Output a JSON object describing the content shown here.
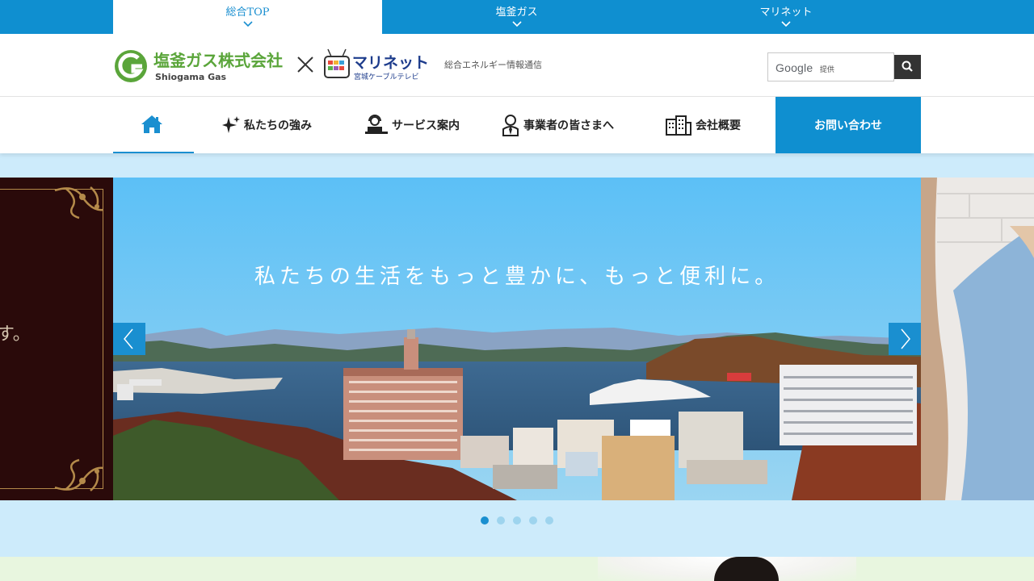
{
  "top_tabs": [
    {
      "label": "総合TOP",
      "active": true
    },
    {
      "label": "塩釜ガス",
      "active": false
    },
    {
      "label": "マリネット",
      "active": false
    }
  ],
  "header": {
    "logo_shiogama_jp": "塩釜ガス株式会社",
    "logo_shiogama_en": "Shiogama Gas",
    "logo_marinet": "マリネット",
    "logo_marinet_sub": "宮城ケーブルテレビ",
    "tagline": "総合エネルギー情報通信",
    "search_brand": "Google",
    "search_provided": "提供"
  },
  "nav": {
    "items": [
      {
        "label": "私たちの強み",
        "icon": "sparkle-icon"
      },
      {
        "label": "サービス案内",
        "icon": "operator-icon"
      },
      {
        "label": "事業者の皆さまへ",
        "icon": "businessperson-icon"
      },
      {
        "label": "会社概要",
        "icon": "building-icon"
      }
    ],
    "contact": "お問い合わせ"
  },
  "slider": {
    "caption": "私たちの生活をもっと豊かに、もっと便利に。",
    "left_peek_text": "す。",
    "slide_count": 5,
    "active_index": 0
  },
  "colors": {
    "brand_blue": "#0f8fd0",
    "slider_band": "#cdebfb",
    "logo_green": "#5aa53a"
  }
}
